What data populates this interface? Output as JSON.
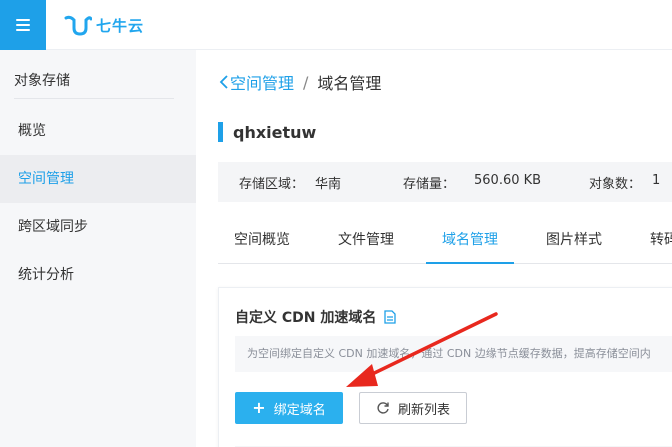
{
  "header": {
    "logo_text": "七牛云",
    "menu_icon": "hamburger-icon",
    "accent_color": "#1ea0e8"
  },
  "sidebar": {
    "title": "对象存储",
    "items": [
      {
        "label": "概览",
        "active": false
      },
      {
        "label": "空间管理",
        "active": true
      },
      {
        "label": "跨区域同步",
        "active": false
      },
      {
        "label": "统计分析",
        "active": false
      }
    ]
  },
  "breadcrumb": {
    "back_label": "空间管理",
    "separator": "/",
    "current": "域名管理"
  },
  "bucket": {
    "name": "qhxietuw",
    "region_label": "存储区域：",
    "region_value": "华南",
    "storage_label": "存储量：",
    "storage_value": "560.60 KB",
    "objects_label": "对象数：",
    "objects_value": "1"
  },
  "tabs": [
    {
      "label": "空间概览",
      "active": false
    },
    {
      "label": "文件管理",
      "active": false
    },
    {
      "label": "域名管理",
      "active": true
    },
    {
      "label": "图片样式",
      "active": false
    },
    {
      "label": "转码",
      "active": false
    }
  ],
  "cdn_section": {
    "title": "自定义 CDN 加速域名",
    "doc_icon": "document-icon",
    "description": "为空间绑定自定义 CDN 加速域名，通过 CDN 边缘节点缓存数据，提高存储空间内",
    "bind_button": "绑定域名",
    "refresh_button": "刷新列表"
  }
}
